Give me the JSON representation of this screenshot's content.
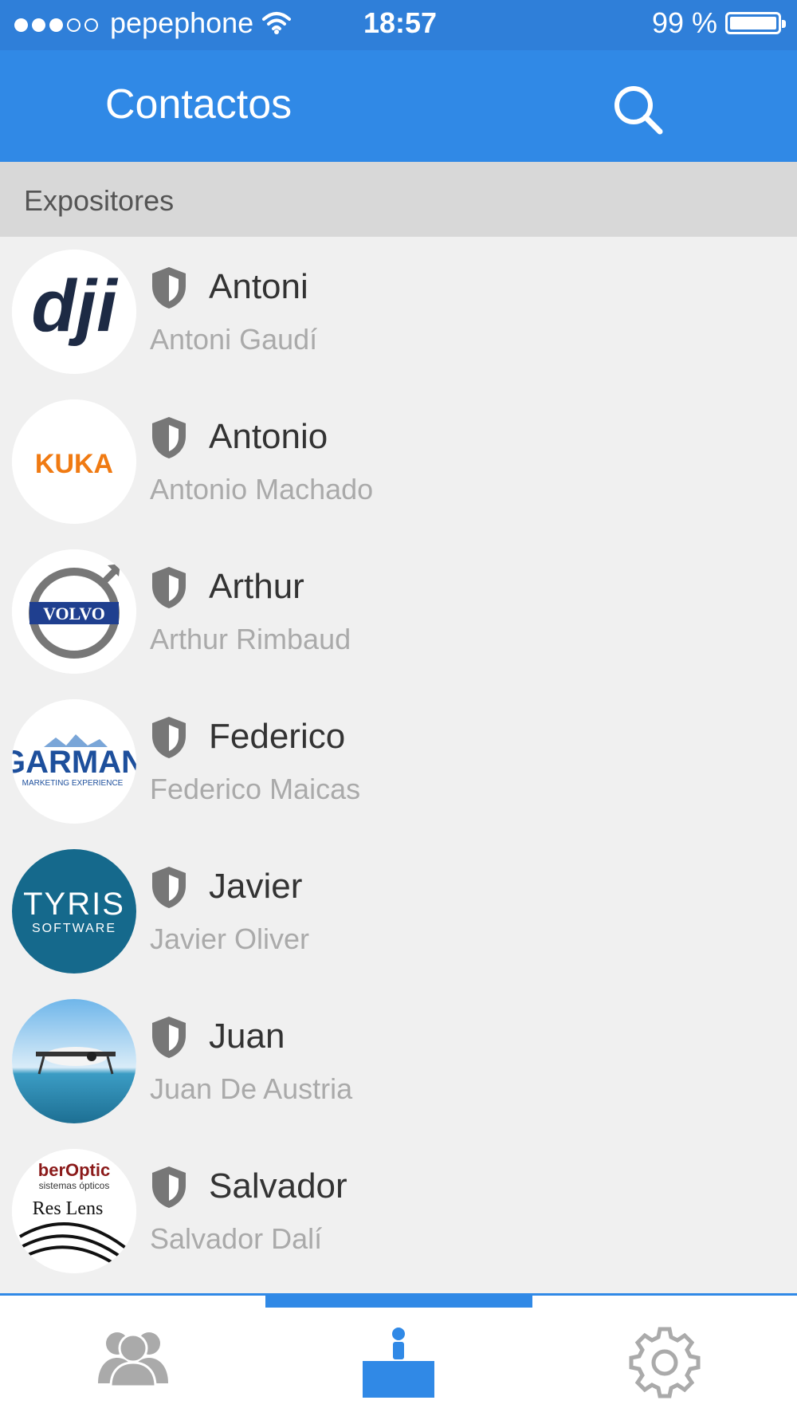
{
  "status": {
    "carrier": "pepephone",
    "time": "18:57",
    "battery": "99 %",
    "signal_bars_filled": 3,
    "signal_bars_total": 5
  },
  "appbar": {
    "title": "Contactos",
    "search_icon": "search-icon"
  },
  "section": {
    "label": "Expositores"
  },
  "contacts": [
    {
      "name": "Antoni",
      "full_name": "Antoni Gaudí",
      "logo": "DJI",
      "icon": "shield-icon"
    },
    {
      "name": "Antonio",
      "full_name": "Antonio Machado",
      "logo": "KUKA",
      "icon": "shield-icon"
    },
    {
      "name": "Arthur",
      "full_name": "Arthur Rimbaud",
      "logo": "VOLVO",
      "icon": "shield-icon"
    },
    {
      "name": "Federico",
      "full_name": "Federico Maicas",
      "logo": "GARMAN",
      "icon": "shield-icon"
    },
    {
      "name": "Javier",
      "full_name": "Javier Oliver",
      "logo": "TYRIS",
      "icon": "shield-icon"
    },
    {
      "name": "Juan",
      "full_name": "Juan De Austria",
      "logo": "drone-photo",
      "icon": "shield-icon"
    },
    {
      "name": "Salvador",
      "full_name": "Salvador Dalí",
      "logo": "Res Lens",
      "icon": "shield-icon"
    }
  ],
  "tabbar": {
    "tabs": [
      {
        "name": "people-icon",
        "active": false
      },
      {
        "name": "exhibitor-stand-icon",
        "active": true
      },
      {
        "name": "gear-icon",
        "active": false
      }
    ]
  },
  "colors": {
    "primary": "#3089e6",
    "status_bar": "#2f7fd9",
    "section_bg": "#d8d8d8",
    "list_bg": "#f0f0f0",
    "icon_gray": "#777777",
    "inactive_tab": "#aaaaaa"
  }
}
